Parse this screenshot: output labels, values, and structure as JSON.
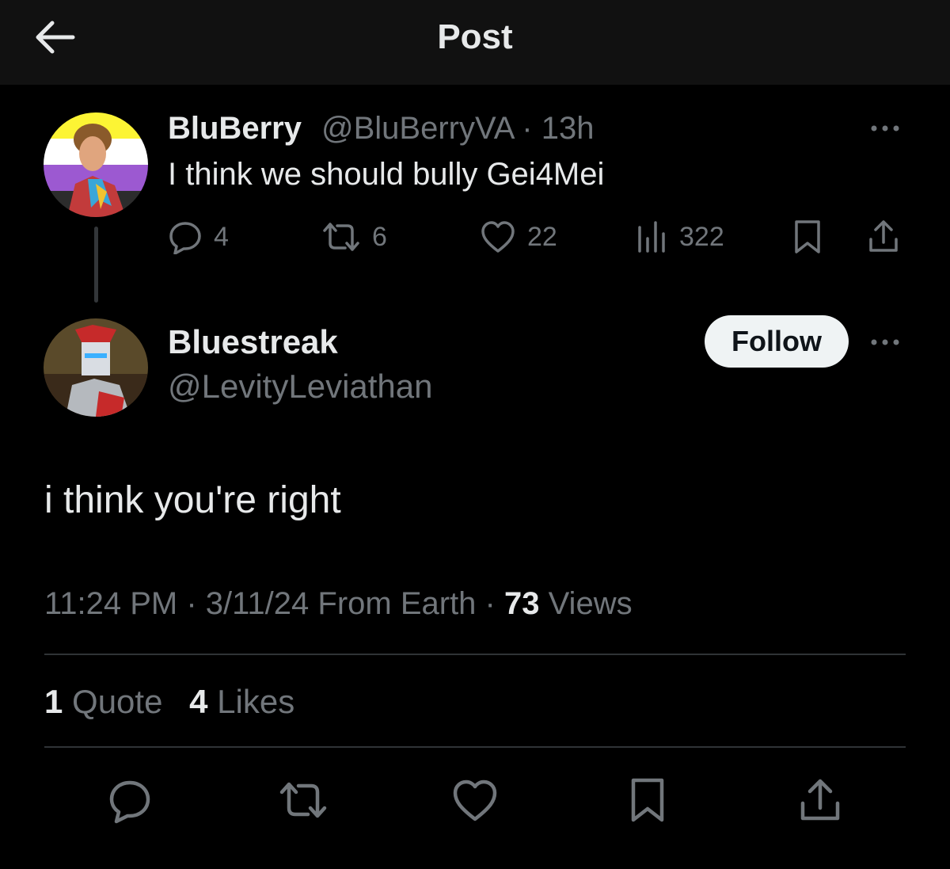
{
  "header": {
    "title": "Post"
  },
  "parent_post": {
    "display_name": "BluBerry",
    "handle": "@BluBerryVA",
    "separator": "·",
    "time": "13h",
    "text": "I think we should bully Gei4Mei",
    "actions": {
      "replies": "4",
      "reposts": "6",
      "likes": "22",
      "views": "322"
    },
    "avatar_flag_colors": [
      "#fcf434",
      "#ffffff",
      "#9c59d1",
      "#2c2c2c"
    ]
  },
  "main_post": {
    "display_name": "Bluestreak",
    "handle": "@LevityLeviathan",
    "follow_label": "Follow",
    "text": "i think you're right",
    "timestamp": "11:24 PM · 3/11/24 From Earth · ",
    "views_count": "73",
    "views_label": " Views",
    "quotes_count": "1",
    "quotes_label": " Quote",
    "likes_count": "4",
    "likes_label": " Likes"
  },
  "colors": {
    "background": "#000000",
    "header_bg": "#111111",
    "text_primary": "#e7e9ea",
    "text_secondary": "#71767b",
    "divider": "#2f3336",
    "follow_bg": "#eff3f4"
  },
  "icons": [
    "back-arrow-icon",
    "more-icon",
    "reply-icon",
    "repost-icon",
    "like-icon",
    "views-icon",
    "bookmark-icon",
    "share-icon"
  ]
}
